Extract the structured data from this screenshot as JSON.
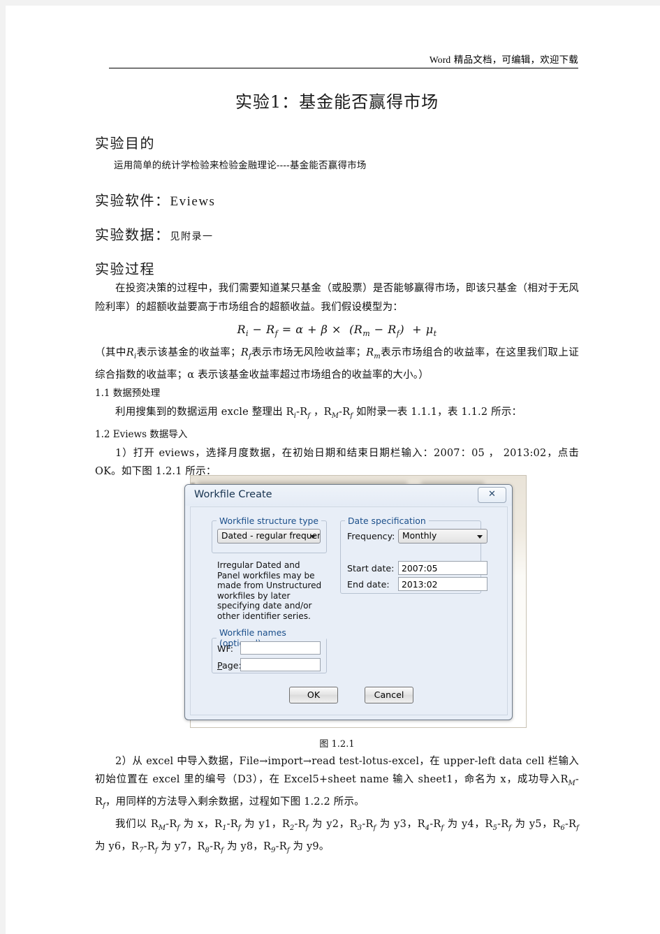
{
  "header": {
    "word_label": "Word",
    "text": "精品文档，可编辑，欢迎下载"
  },
  "document": {
    "title": "实验1：基金能否赢得市场",
    "sections": {
      "purpose_heading": "实验目的",
      "purpose_body": "运用简单的统计学检验来检验金融理论----基金能否赢得市场",
      "software_heading": "实验软件：",
      "software_value": "Eviews",
      "data_heading": "实验数据：",
      "data_value": "见附录一",
      "process_heading": "实验过程",
      "process_p1": "在投资决策的过程中，我们需要知道某只基金（或股票）是否能够赢得市场，即该只基金（相对于无风险利率）的超额收益要高于市场组合的超额收益。我们假设模型为：",
      "formula": "R_i − R_f = α + β × (R_m − R_f) + μ_t",
      "formula_note_1": "（其中",
      "formula_note_2": "表示该基金的收益率；",
      "formula_note_3": "表示市场无风险收益率；",
      "formula_note_4": "表示市场组合的收益率，在这里我们取上证综合指数的收益率；α 表示该基金收益率超过市场组合的收益率的大小。）",
      "sec_1_1": "1.1 数据预处理",
      "sec_1_1_body_a": "利用搜集到的数据运用 excle 整理出 R",
      "sec_1_1_body_b": "如附录一表 1.1.1，表 1.1.2 所示：",
      "sec_1_2": "1.2 Eviews 数据导入",
      "step_1": "1）打开 eviews，选择月度数据，在初始日期和结束日期栏输入：2007：05 ， 2013:02，点击 OK。如下图 1.2.1 所示：",
      "fig_caption_1": "图 1.2.1",
      "step_2_a": "2）从 excel 中导入数据，File→import→read test-lotus-excel，在 upper-left data cell 栏输入初始位置在 excel 里的编号（D3），在 Excel5+sheet name 输入 sheet1，命名为 x，成功导入",
      "step_2_b": "，用同样的方法导入剩余数据，过程如下图 1.2.2 所示。",
      "step_3_prefix": "我们以",
      "step_3_mapping": [
        {
          "expr": "R_M-R_f",
          "var": "x"
        },
        {
          "expr": "R_1-R_f",
          "var": "y1"
        },
        {
          "expr": "R_2-R_f",
          "var": "y2"
        },
        {
          "expr": "R_3-R_f",
          "var": "y3"
        },
        {
          "expr": "R_4-R_f",
          "var": "y4"
        },
        {
          "expr": "R_5-R_f",
          "var": "y5"
        },
        {
          "expr": "R_6-R_f",
          "var": "y6"
        },
        {
          "expr": "R_7-R_f",
          "var": "y7"
        },
        {
          "expr": "R_8-R_f",
          "var": "y8"
        },
        {
          "expr": "R_9-R_f",
          "var": "y9"
        }
      ]
    }
  },
  "dialog": {
    "title": "Workfile Create",
    "close_icon": "✕",
    "groups": {
      "structure_legend": "Workfile structure type",
      "datespec_legend": "Date specification",
      "names_legend": "Workfile names (optional)"
    },
    "structure_combo_value": "Dated - regular frequency",
    "help_text": "Irregular Dated and Panel workfiles may be made from Unstructured workfiles by later specifying date and/or other identifier series.",
    "frequency_label": "Frequency:",
    "frequency_value": "Monthly",
    "start_date_label": "Start date:",
    "start_date_value": "2007:05",
    "end_date_label": "End date:",
    "end_date_value": "2013:02",
    "wf_label": "WF:",
    "wf_value": "",
    "page_label": "Page:",
    "page_value": "",
    "ok_label": "OK",
    "cancel_label": "Cancel"
  }
}
